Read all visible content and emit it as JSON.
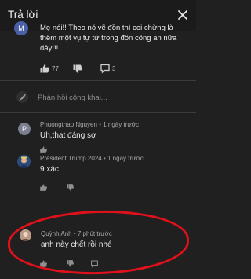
{
  "header": {
    "title": "Trả lời",
    "close_icon": "close-icon"
  },
  "parent_comment": {
    "avatar_letter": "M",
    "avatar_color": "#4a5fa8",
    "text_lines": [
      "Mẹ nói!! Theo nó vẽ đồn thì coi chừng là",
      "thêm một vụ tự tử trong đồn công an nữa",
      "đây!!!"
    ],
    "likes": "77",
    "replies": "3"
  },
  "reply_input": {
    "placeholder": "Phản hồi công khai..."
  },
  "replies": [
    {
      "author": "Phuongthao Nguyen",
      "time": "1 ngày trước",
      "text": "Uh,that đáng sợ",
      "avatar_letter": "P",
      "avatar_color": "#7c7f8f"
    },
    {
      "author": "President Trump 2024",
      "time": "1 ngày trước",
      "text": "9 xác",
      "avatar_color": "#2c4a7a"
    },
    {
      "author": "Quỳnh Anh",
      "time": "7 phút trước",
      "text": "anh này chết rồi nhé",
      "avatar_color": "#8d6e63"
    }
  ],
  "colors": {
    "background": "#202020",
    "highlight_ring": "#e0111a"
  }
}
